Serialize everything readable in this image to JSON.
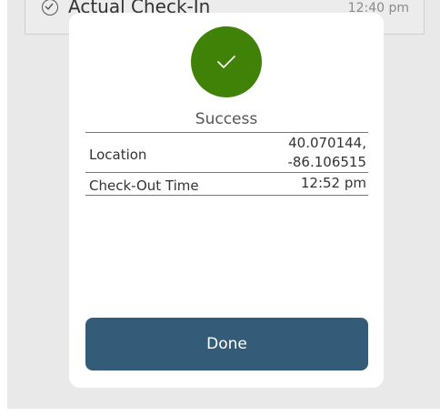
{
  "background": {
    "row_label": "Actual Check-In",
    "row_time": "12:40 pm"
  },
  "modal": {
    "title": "Success",
    "rows": [
      {
        "label": "Location",
        "value_line1": "40.070144,",
        "value_line2": "-86.106515"
      },
      {
        "label": "Check-Out Time",
        "value": "12:52 pm"
      }
    ],
    "done_label": "Done"
  },
  "colors": {
    "success": "#3f8207",
    "button": "#345b78"
  },
  "icons": {
    "success": "checkmark-icon",
    "row_status": "check-circle-icon"
  }
}
